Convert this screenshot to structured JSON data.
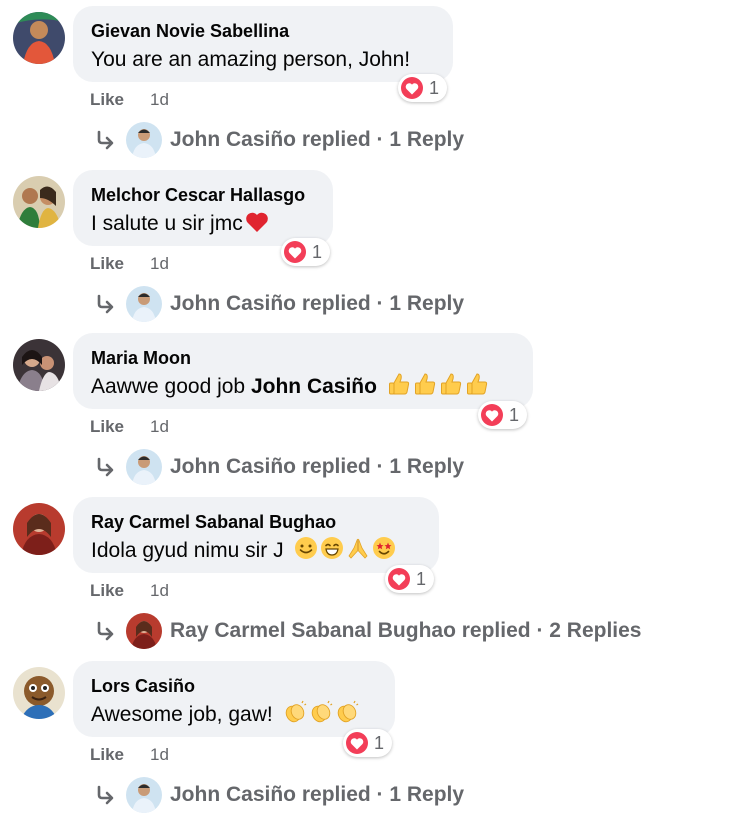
{
  "comments": [
    {
      "author": "Gievan Novie Sabellina",
      "text": "You are an amazing person, John!",
      "emojis": [],
      "reaction_count": "1",
      "like": "Like",
      "time": "1d",
      "reply": "John Casiño replied · 1 Reply"
    },
    {
      "author": "Melchor Cescar Hallasgo",
      "text": "I salute u sir jmc",
      "emojis": [
        "red-heart-emoji"
      ],
      "reaction_count": "1",
      "like": "Like",
      "time": "1d",
      "reply": "John Casiño replied · 1 Reply"
    },
    {
      "author": "Maria Moon",
      "text": "Aawwe good job ",
      "mention": "John Casiño",
      "emojis": [
        "thumbs-up-emoji",
        "thumbs-up-emoji",
        "thumbs-up-emoji",
        "thumbs-up-emoji"
      ],
      "reaction_count": "1",
      "like": "Like",
      "time": "1d",
      "reply": "John Casiño replied · 1 Reply"
    },
    {
      "author": "Ray Carmel Sabanal Bughao",
      "text": "Idola gyud nimu sir J",
      "emojis": [
        "smiling-emoji",
        "grinning-emoji",
        "folded-hands-emoji",
        "star-struck-emoji"
      ],
      "reaction_count": "1",
      "like": "Like",
      "time": "1d",
      "reply": "Ray Carmel Sabanal Bughao replied · 2 Replies"
    },
    {
      "author": "Lors Casiño",
      "text": "Awesome job, gaw!",
      "emojis": [
        "clapping-hands-emoji",
        "clapping-hands-emoji",
        "clapping-hands-emoji"
      ],
      "reaction_count": "1",
      "like": "Like",
      "time": "1d",
      "reply": "John Casiño replied · 1 Reply"
    }
  ],
  "colors": {
    "bubble": "#f0f2f5",
    "secondary_text": "#65676b",
    "love_reaction": "#f33e58",
    "emoji_yellow": "#ffcc4d"
  }
}
